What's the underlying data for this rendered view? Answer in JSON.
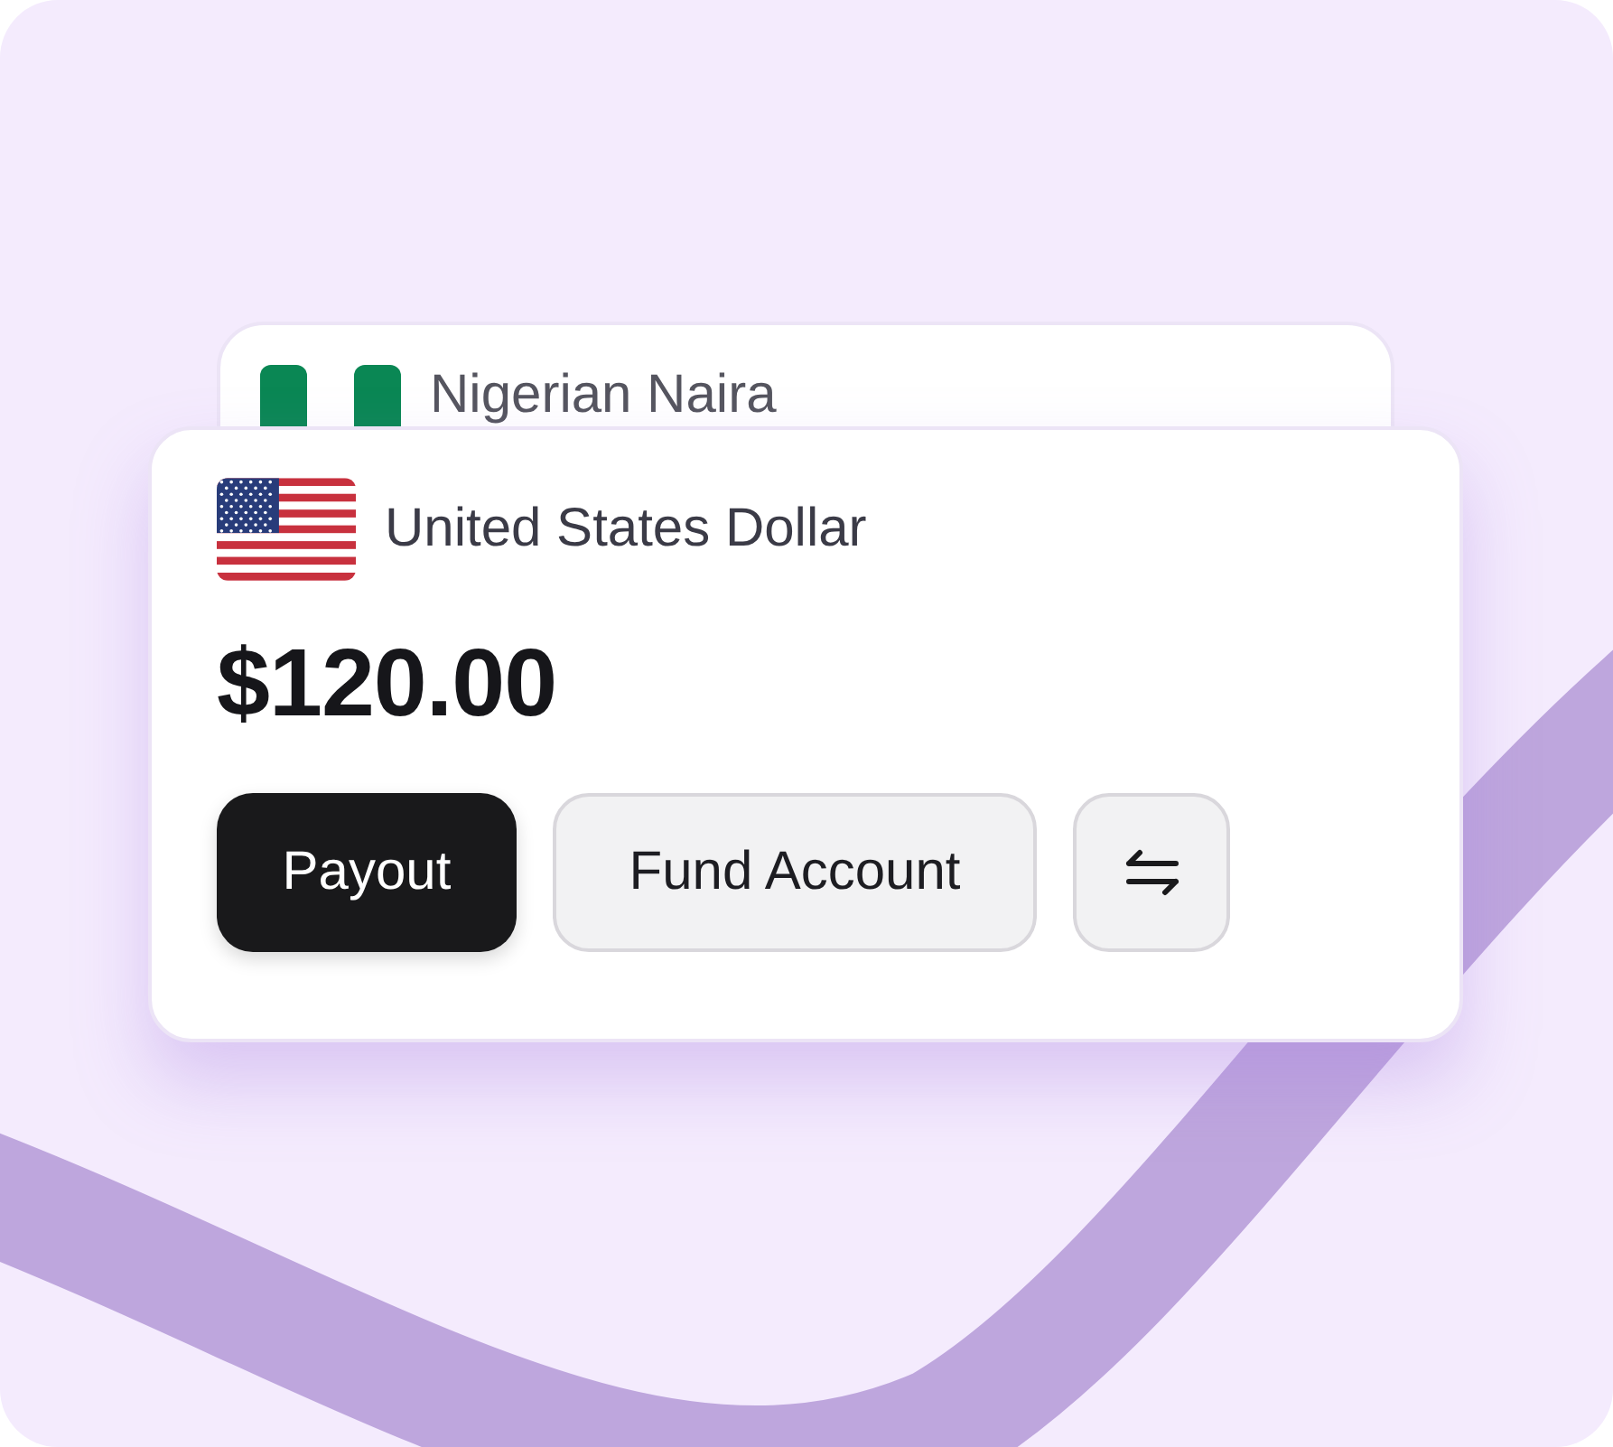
{
  "background_card": {
    "currency": "Nigerian Naira"
  },
  "card": {
    "currency": "United States Dollar",
    "balance": "$120.00",
    "buttons": [
      {
        "label": "Payout",
        "kind": "primary"
      },
      {
        "label": "Fund Account",
        "kind": "secondary"
      },
      {
        "kind": "swap"
      }
    ]
  }
}
